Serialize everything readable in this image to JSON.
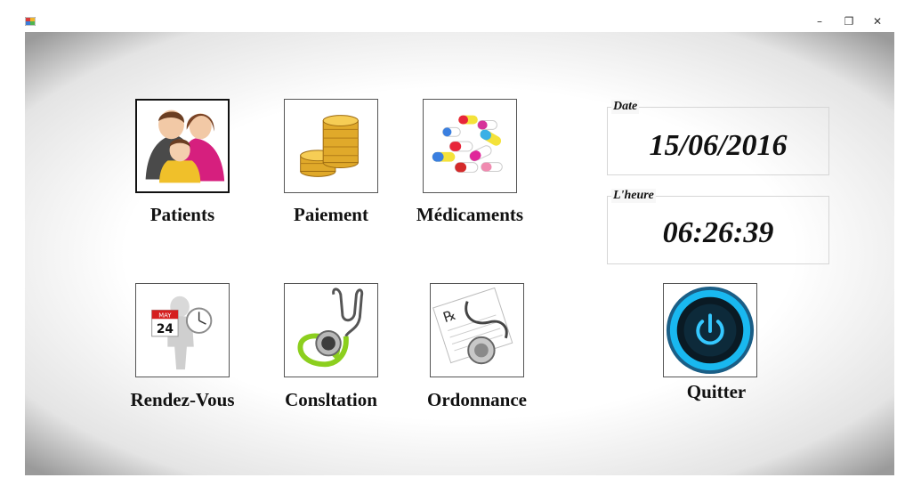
{
  "window": {
    "icon": "app-icon",
    "controls": {
      "minimize": "–",
      "maximize": "❐",
      "close": "✕"
    }
  },
  "menu": {
    "patients": {
      "label": "Patients",
      "icon": "family-icon"
    },
    "paiement": {
      "label": "Paiement",
      "icon": "coins-icon"
    },
    "medicaments": {
      "label": "Médicaments",
      "icon": "pills-icon"
    },
    "rendezvous": {
      "label": "Rendez-Vous",
      "icon": "calendar-clock-icon"
    },
    "consultation": {
      "label": "Consltation",
      "icon": "stethoscope-icon"
    },
    "ordonnance": {
      "label": "Ordonnance",
      "icon": "prescription-icon"
    },
    "quitter": {
      "label": "Quitter",
      "icon": "power-icon"
    }
  },
  "date": {
    "title": "Date",
    "value": "15/06/2016"
  },
  "time": {
    "title": "L'heure",
    "value": "06:26:39"
  },
  "calendar": {
    "month": "MAY",
    "day": "24"
  },
  "prescription": {
    "symbol": "℞"
  },
  "colors": {
    "power_glow": "#19b8f0",
    "stethoscope_green": "#8ccf1e",
    "calendar_red": "#d51f1f"
  }
}
